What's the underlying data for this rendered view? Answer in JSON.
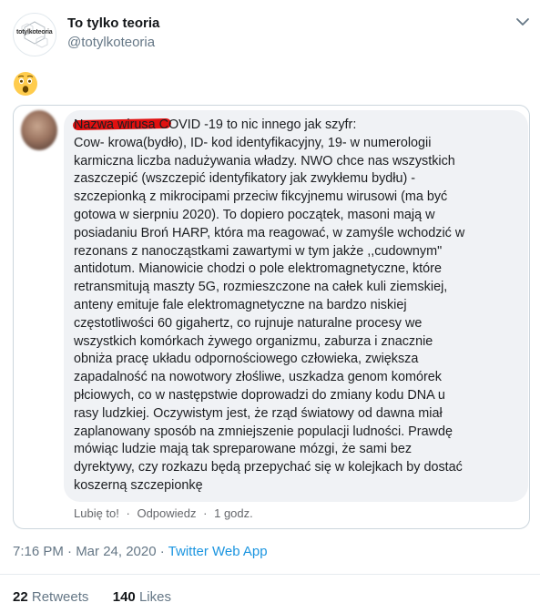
{
  "tweet": {
    "author_name": "To tylko teoria",
    "author_handle": "@totylkoteoria",
    "avatar_logo_text": "totylkoteoria",
    "emoji": "😲",
    "timestamp": "7:16 PM · Mar 24, 2020",
    "dot_separator": "·",
    "source": "Twitter Web App",
    "retweets_count": "22",
    "retweets_label": "Retweets",
    "likes_count": "140",
    "likes_label": "Likes"
  },
  "embedded_post": {
    "comment_text": "Nazwa wirusa COVID -19 to nic innego jak szyfr:\nCow- krowa(bydło), ID- kod identyfikacyjny, 19- w numerologii\nkarmiczna liczba nadużywania władzy. NWO chce nas wszystkich\nzaszczepić (wszczepić identyfikatory jak zwykłemu bydłu) -\nszczepionką z mikrocipami przeciw fikcyjnemu wirusowi (ma być\ngotowa w sierpniu 2020). To dopiero początek, masoni mają w\nposiadaniu Broń HARP, która ma reagować, w zamyśle wchodzić w\nrezonans z nanocząstkami zawartymi w tym jakże ,,cudownym\"\nantidotum. Mianowicie chodzi o pole elektromagnetyczne, które\nretransmitują maszty 5G, rozmieszczone na całek kuli ziemskiej,\nanteny emituje fale elektromagnetyczne na bardzo niskiej\nczęstotliwości 60 gigahertz, co rujnuje naturalne procesy we\nwszystkich komórkach żywego organizmu, zaburza i znacznie\nobniża pracę układu odpornościowego człowieka, zwiększa\nzapadalność na nowotwory złośliwe, uszkadza genom komórek\npłciowych, co w następstwie doprowadzi do zmiany kodu DNA u\nrasy ludzkiej. Oczywistym jest, że rząd światowy od dawna miał\nzaplanowany sposób na zmniejszenie populacji ludności. Prawdę\nmówiąc ludzie mają tak spreparowane mózgi, że sami bez\ndyrektywy, czy rozkazu będą przepychać się w kolejkach by dostać\nkoszerną szczepionkę",
    "like_label": "Lubię to!",
    "reply_label": "Odpowiedz",
    "time_label": "1 godz.",
    "separator": "·"
  },
  "colors": {
    "link_blue": "#1b95e0",
    "secondary_text": "#657786",
    "redaction_red": "#e01010",
    "bubble_bg": "#f0f2f5"
  },
  "icons": [
    "chevron-down-icon",
    "astonished-face-emoji"
  ]
}
